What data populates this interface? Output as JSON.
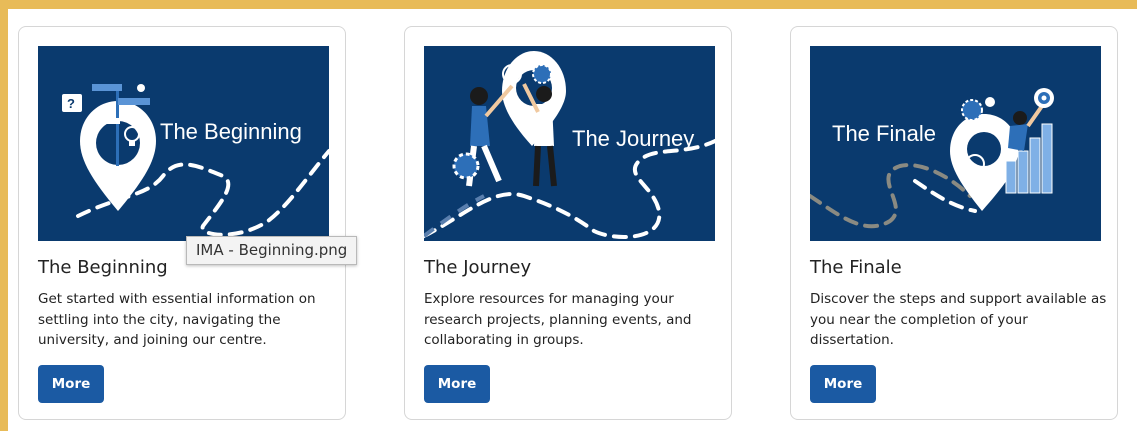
{
  "colors": {
    "frame": "#e8bb58",
    "image_background": "#0a3a6e",
    "button": "#1b5aa3",
    "path_dash": "#ffffff",
    "path_dash_muted": "#8a8a82"
  },
  "cards": [
    {
      "image_caption": "The Beginning",
      "title": "The Beginning",
      "description": "Get started with essential information on settling into the city, navigating the university, and joining our centre.",
      "button_label": "More"
    },
    {
      "image_caption": "The Journey",
      "title": "The Journey",
      "description": "Explore resources for managing your research projects, planning events, and collaborating in groups.",
      "button_label": "More"
    },
    {
      "image_caption": "The Finale",
      "title": "The Finale",
      "description": "Discover the steps and support available as you near the completion of your dissertation.",
      "button_label": "More"
    }
  ],
  "tooltip": {
    "text": "IMA - Beginning.png"
  },
  "icons": [
    "location-pin-icon",
    "signpost-icon",
    "question-bubble-icon",
    "lightbulb-icon",
    "gear-icon",
    "target-icon",
    "bar-chart-icon"
  ]
}
